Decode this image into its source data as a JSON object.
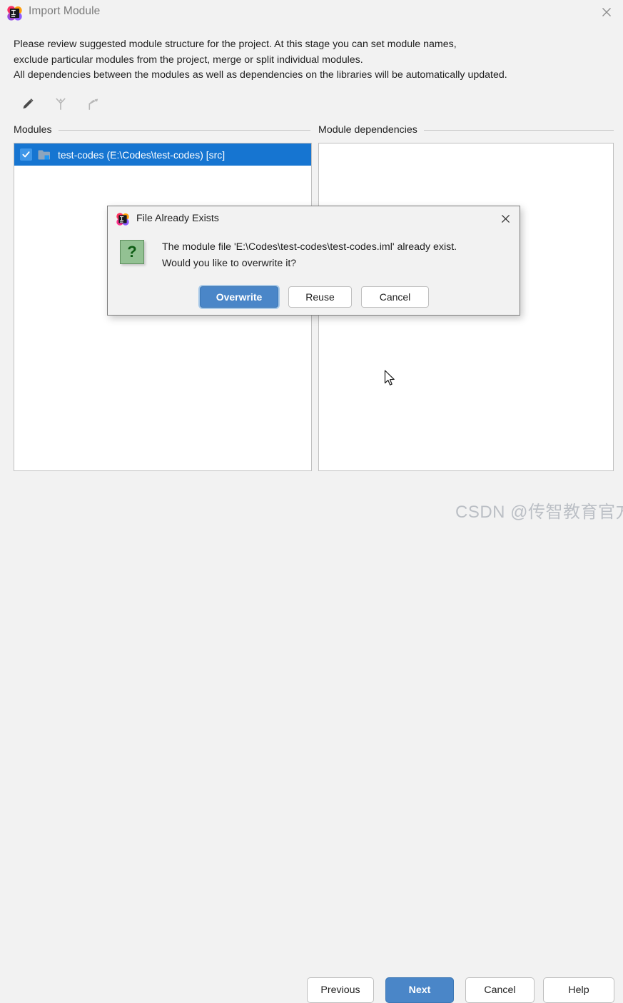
{
  "window": {
    "title": "Import Module",
    "app_icon": "intellij-idea-logo",
    "close_icon": "close-icon"
  },
  "description": {
    "lines": [
      "Please review suggested module structure for the project. At this stage you can set module names,",
      "exclude particular modules from the project, merge or split individual modules.",
      "All dependencies between the modules as well as dependencies on the libraries will be automatically updated."
    ]
  },
  "toolbar": {
    "items": [
      {
        "name": "edit-pencil-icon",
        "tooltip": "Edit"
      },
      {
        "name": "merge-modules-icon",
        "tooltip": "Merge"
      },
      {
        "name": "split-module-icon",
        "tooltip": "Split"
      }
    ]
  },
  "modules_section": {
    "header": "Modules",
    "rows": [
      {
        "label": "test-codes (E:\\Codes\\test-codes) [src]",
        "checked": true,
        "selected": true,
        "icon": "folder-icon"
      }
    ]
  },
  "dependencies_section": {
    "header": "Module dependencies",
    "rows": []
  },
  "footer": {
    "buttons": [
      {
        "label": "Previous",
        "style": "default"
      },
      {
        "label": "Next",
        "style": "primary"
      },
      {
        "label": "Cancel",
        "style": "default"
      },
      {
        "label": "Help",
        "style": "default"
      }
    ]
  },
  "dialog": {
    "title": "File Already Exists",
    "app_icon": "intellij-idea-logo",
    "close_icon": "close-icon",
    "severity_icon": "question-icon",
    "severity_glyph": "?",
    "message_lines": [
      "The module file 'E:\\Codes\\test-codes\\test-codes.iml' already exist.",
      "Would you like to overwrite it?"
    ],
    "buttons": [
      {
        "label": "Overwrite",
        "style": "primary",
        "focused": true
      },
      {
        "label": "Reuse",
        "style": "default",
        "focused": false
      },
      {
        "label": "Cancel",
        "style": "default",
        "focused": false
      }
    ]
  },
  "watermark": {
    "text": "CSDN @传智教育官方博客"
  },
  "colors": {
    "accent_blue": "#4a86c8",
    "selection_blue": "#1675d1",
    "window_bg": "#f2f2f2",
    "panel_bg": "#ffffff",
    "question_green": "#93c193"
  }
}
